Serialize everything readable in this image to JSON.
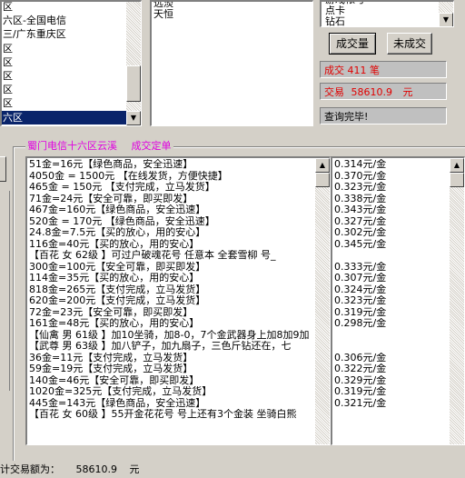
{
  "region_list": {
    "items": [
      "区",
      "六区-全国电信",
      "三/广东重庆区",
      "区",
      "区",
      "区",
      "区",
      "区",
      "六区"
    ],
    "selected_index": 8
  },
  "server_list": {
    "items": [
      "远淡",
      "天恒"
    ]
  },
  "account_list": {
    "items": [
      "游戏帐号",
      "点卡",
      "钻石"
    ]
  },
  "buttons": {
    "done": "成交量",
    "undone": "未成交"
  },
  "stats": {
    "deals_label": "成交",
    "deals_count": "411",
    "deals_unit": "笔",
    "amount_label": "交易",
    "amount_value": "58610.9",
    "amount_unit": "元",
    "status": "查询完毕!"
  },
  "group": {
    "title": "蜀门电信十六区云溪",
    "subtitle": "成交定单"
  },
  "orders": [
    "51金=16元【绿色商品，安全迅速】",
    "4050金 = 1500元 【在线发货，方便快捷】",
    "465金 = 150元 【支付完成，立马发货】",
    "71金=24元【安全可靠，即买即发】",
    "467金=160元【绿色商品，安全迅速】",
    "520金 = 170元 【绿色商品，安全迅速】",
    "24.8金=7.5元【买的放心，用的安心】",
    "116金=40元【买的放心，用的安心】",
    "【百花 女 62级 】可过户破魂花号 任意本 全套雪柳 号_",
    "300金=100元【安全可靠，即买即发】",
    "114金=35元【买的放心，用的安心】",
    "818金=265元【支付完成，立马发货】",
    "620金=200元【支付完成，立马发货】",
    "72金=23元【安全可靠，即买即发】",
    "161金=48元【买的放心，用的安心】",
    "【仙禽 男 61级 】加10坐骑，加8-0，7个金武器身上加8加9加",
    "【武尊 男 63级 】加八铲子，加九扇子，三色斤钻还在，七",
    "36金=11元【支付完成，立马发货】",
    "59金=19元【支付完成，立马发货】",
    "140金=46元【安全可靠，即买即发】",
    "1020金=325元【支付完成，立马发货】",
    "445金=143元【绿色商品，安全迅速】",
    "【百花 女 60级 】55开金花花号 号上还有3个金装 坐骑白熊"
  ],
  "prices": [
    "0.314元/金",
    "0.370元/金",
    "0.323元/金",
    "0.338元/金",
    "0.343元/金",
    "0.327元/金",
    "0.302元/金",
    "0.345元/金",
    "",
    "0.333元/金",
    "0.307元/金",
    "0.324元/金",
    "0.323元/金",
    "0.319元/金",
    "0.298元/金",
    "",
    "",
    "0.306元/金",
    "0.322元/金",
    "0.329元/金",
    "0.319元/金",
    "0.321元/金",
    ""
  ],
  "footer": {
    "label": "计交易额为：",
    "value": "58610.9",
    "unit": "元"
  }
}
